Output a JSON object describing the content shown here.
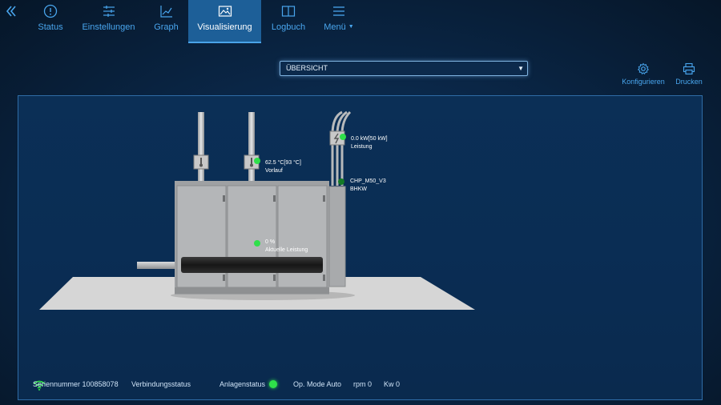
{
  "nav": {
    "tabs": [
      {
        "label": "Status",
        "icon": "info-icon"
      },
      {
        "label": "Einstellungen",
        "icon": "sliders-icon"
      },
      {
        "label": "Graph",
        "icon": "chart-icon"
      },
      {
        "label": "Visualisierung",
        "icon": "image-icon",
        "active": true
      },
      {
        "label": "Logbuch",
        "icon": "book-icon"
      },
      {
        "label": "Menü",
        "icon": "menu-icon"
      }
    ]
  },
  "view_select": {
    "value": "ÜBERSICHT"
  },
  "tools": {
    "configure": "Konfigurieren",
    "print": "Drucken"
  },
  "scene": {
    "power": {
      "value": "0.0 kW[50 kW]",
      "name": "Leistung"
    },
    "flow": {
      "value": "62.5 °C[93 °C]",
      "name": "Vorlauf"
    },
    "unit": {
      "value": "CHP_M50_V3",
      "name": "BHKW"
    },
    "load": {
      "value": "0 %",
      "name": "Aktuelle Leistung"
    }
  },
  "status_bar": {
    "serial": "Seriennummer 100858078",
    "connection": "Verbindungsstatus",
    "plant": "Anlagenstatus",
    "mode": "Op. Mode Auto",
    "rpm": "rpm 0",
    "kw": "Kw 0"
  },
  "colors": {
    "accent": "#49a6ee",
    "active_tab": "#1d5f98",
    "ok": "#2fe04a"
  }
}
